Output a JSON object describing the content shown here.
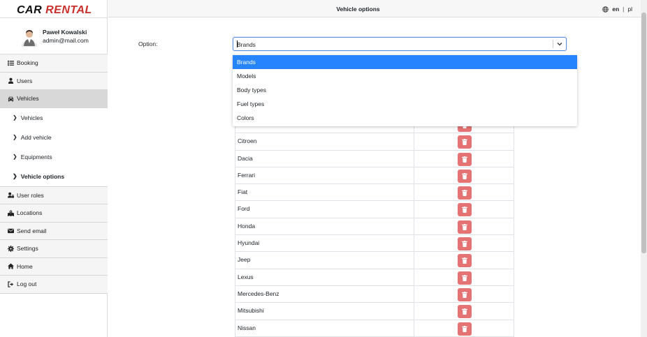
{
  "brand": {
    "part1": "CAR",
    "part2": "RENTAL"
  },
  "user": {
    "name": "Paweł Kowalski",
    "email": "admin@mail.com"
  },
  "menu": {
    "booking": "Booking",
    "users": "Users",
    "vehicles": "Vehicles",
    "vehicles_sub": [
      "Vehicles",
      "Add vehicle",
      "Equipments",
      "Vehicle options"
    ],
    "user_roles": "User roles",
    "locations": "Locations",
    "send_email": "Send email",
    "settings": "Settings",
    "home": "Home",
    "logout": "Log out"
  },
  "header": {
    "title": "Vehicle options",
    "lang_en": "en",
    "lang_sep": "|",
    "lang_pl": "pl"
  },
  "form": {
    "label": "Option:",
    "selected": "Brands"
  },
  "dropdown": {
    "options": [
      "Brands",
      "Models",
      "Body types",
      "Fuel types",
      "Colors"
    ],
    "selected_index": 0
  },
  "table": {
    "rows": [
      "",
      "Citroen",
      "Dacia",
      "Ferrari",
      "Fiat",
      "Ford",
      "Honda",
      "Hyundai",
      "Jeep",
      "Lexus",
      "Mercedes-Benz",
      "Mitsubishi",
      "Nissan"
    ]
  },
  "colors": {
    "brand_red": "#c9302c",
    "select_blue": "#2684ff",
    "delete_red": "#e57373",
    "active_menu": "#d8d8d8"
  }
}
